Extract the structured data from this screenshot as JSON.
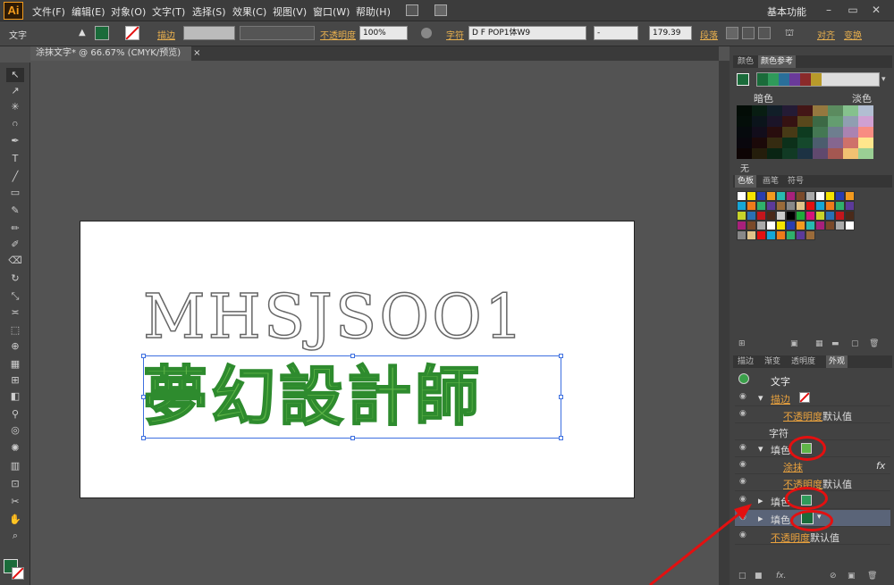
{
  "app": {
    "logo": "Ai",
    "workspace": "基本功能",
    "colors": {
      "accent": "#f29b1d",
      "fill_dark": "#1a6b3a",
      "fill_light": "#5fb548",
      "sel": "#3d6fe0"
    }
  },
  "menu": [
    "文件(F)",
    "编辑(E)",
    "对象(O)",
    "文字(T)",
    "选择(S)",
    "效果(C)",
    "视图(V)",
    "窗口(W)",
    "帮助(H)"
  ],
  "control": {
    "type_label": "文字",
    "stroke_label": "描边",
    "opacity_label": "不透明度",
    "opacity_value": "100%",
    "char_label": "字符",
    "font": "D F POP1体W9",
    "style": "-",
    "size": "179.39",
    "para_label": "段落",
    "align_label": "对齐",
    "transform_label": "变换"
  },
  "document": {
    "tab": "涂抹文字* @ 66.67% (CMYK/预览)",
    "line1": "MHSJSOO1",
    "line2": "夢幻設計師"
  },
  "color_guide": {
    "tabs": [
      "颜色",
      "颜色参考"
    ],
    "dark_label": "暗色",
    "light_label": "淡色",
    "none_label": "无"
  },
  "swatches": {
    "tabs": [
      "色板",
      "画笔",
      "符号"
    ]
  },
  "appearance": {
    "tabs": [
      "描边",
      "渐变",
      "透明度",
      "外观"
    ],
    "object": "文字",
    "stroke": "描边",
    "opacity": "不透明度",
    "default": "默认值",
    "chars": "字符",
    "fill1": "填色",
    "scribble": "涂抹",
    "fill2": "填色",
    "fill3": "填色",
    "fx": "fx"
  }
}
